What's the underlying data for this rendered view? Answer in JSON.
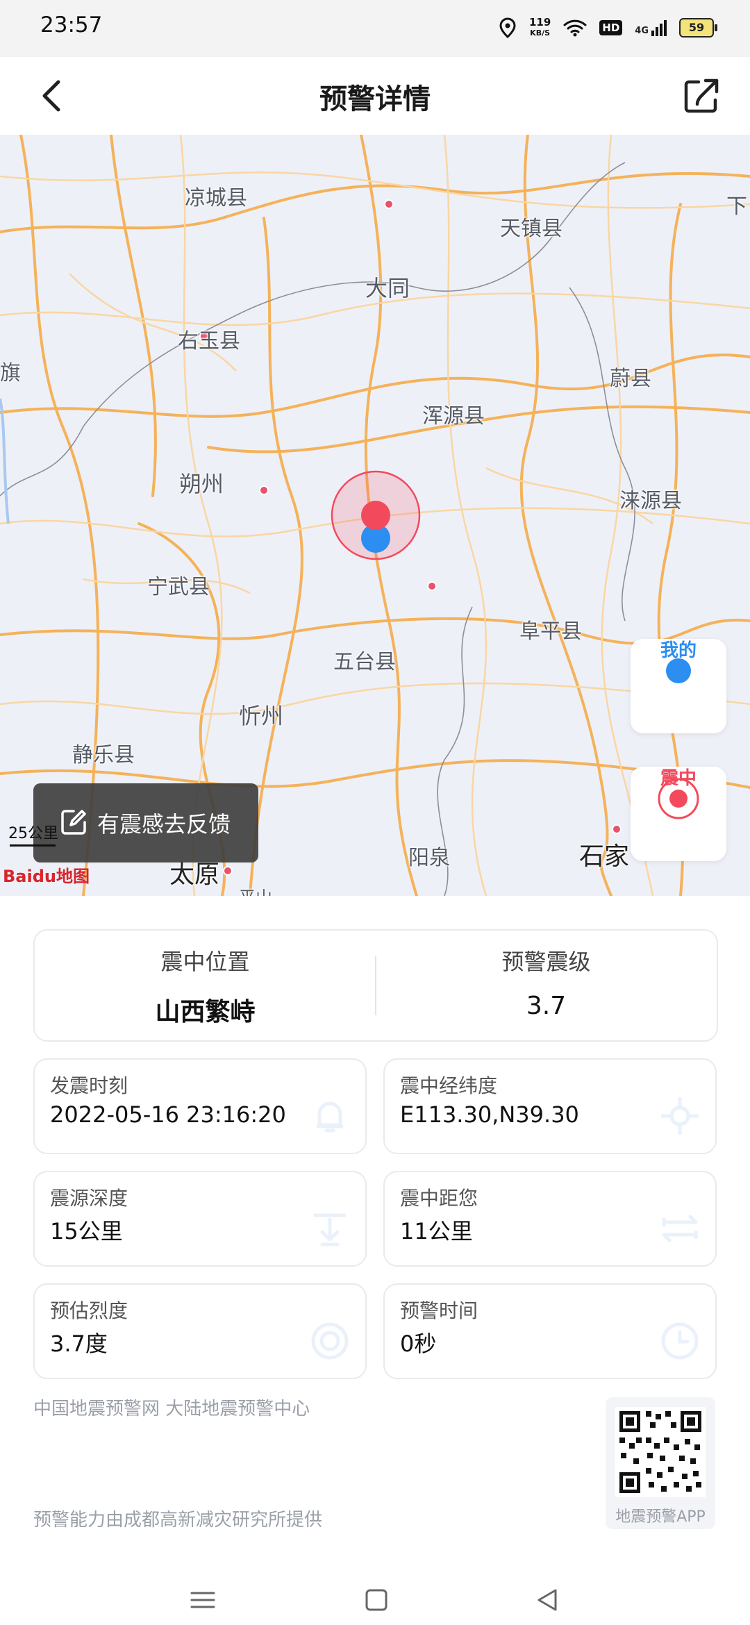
{
  "status_bar": {
    "time": "23:57",
    "net_speed_value": "119",
    "net_speed_unit": "KB/S",
    "hd_label": "HD",
    "network_type": "4G",
    "battery": "59"
  },
  "header": {
    "title": "预警详情"
  },
  "map": {
    "cities": [
      "凉城县",
      "天镇县",
      "大同",
      "右玉县",
      "蔚县",
      "浑源县",
      "朔州",
      "涞源县",
      "宁武县",
      "阜平县",
      "五台县",
      "忻州",
      "静乐县",
      "阳泉",
      "石家",
      "太原",
      "平山",
      "下",
      "旗"
    ],
    "my_location_label": "我的",
    "epicenter_label": "震中",
    "feedback_label": "有震感去反馈",
    "scale_label": "25公里",
    "provider_logo": "Baidu地图",
    "colors": {
      "epicenter": "#f24a5c",
      "me": "#2b8ef0",
      "road": "#f4b25a"
    }
  },
  "summary": {
    "location_caption": "震中位置",
    "location_value": "山西繁峙",
    "magnitude_caption": "预警震级",
    "magnitude_value": "3.7"
  },
  "details": [
    {
      "caption": "发震时刻",
      "value": "2022-05-16 23:16:20",
      "icon": "bell-icon"
    },
    {
      "caption": "震中经纬度",
      "value": "E113.30,N39.30",
      "icon": "crosshair-icon"
    },
    {
      "caption": "震源深度",
      "value": "15公里",
      "icon": "depth-icon"
    },
    {
      "caption": "震中距您",
      "value": "11公里",
      "icon": "distance-icon"
    },
    {
      "caption": "预估烈度",
      "value": "3.7度",
      "icon": "target-icon"
    },
    {
      "caption": "预警时间",
      "value": "0秒",
      "icon": "clock-icon"
    }
  ],
  "footer": {
    "source": "中国地震预警网 大陆地震预警中心",
    "provider": "预警能力由成都高新减灾研究所提供",
    "qr_caption": "地震预警APP"
  }
}
